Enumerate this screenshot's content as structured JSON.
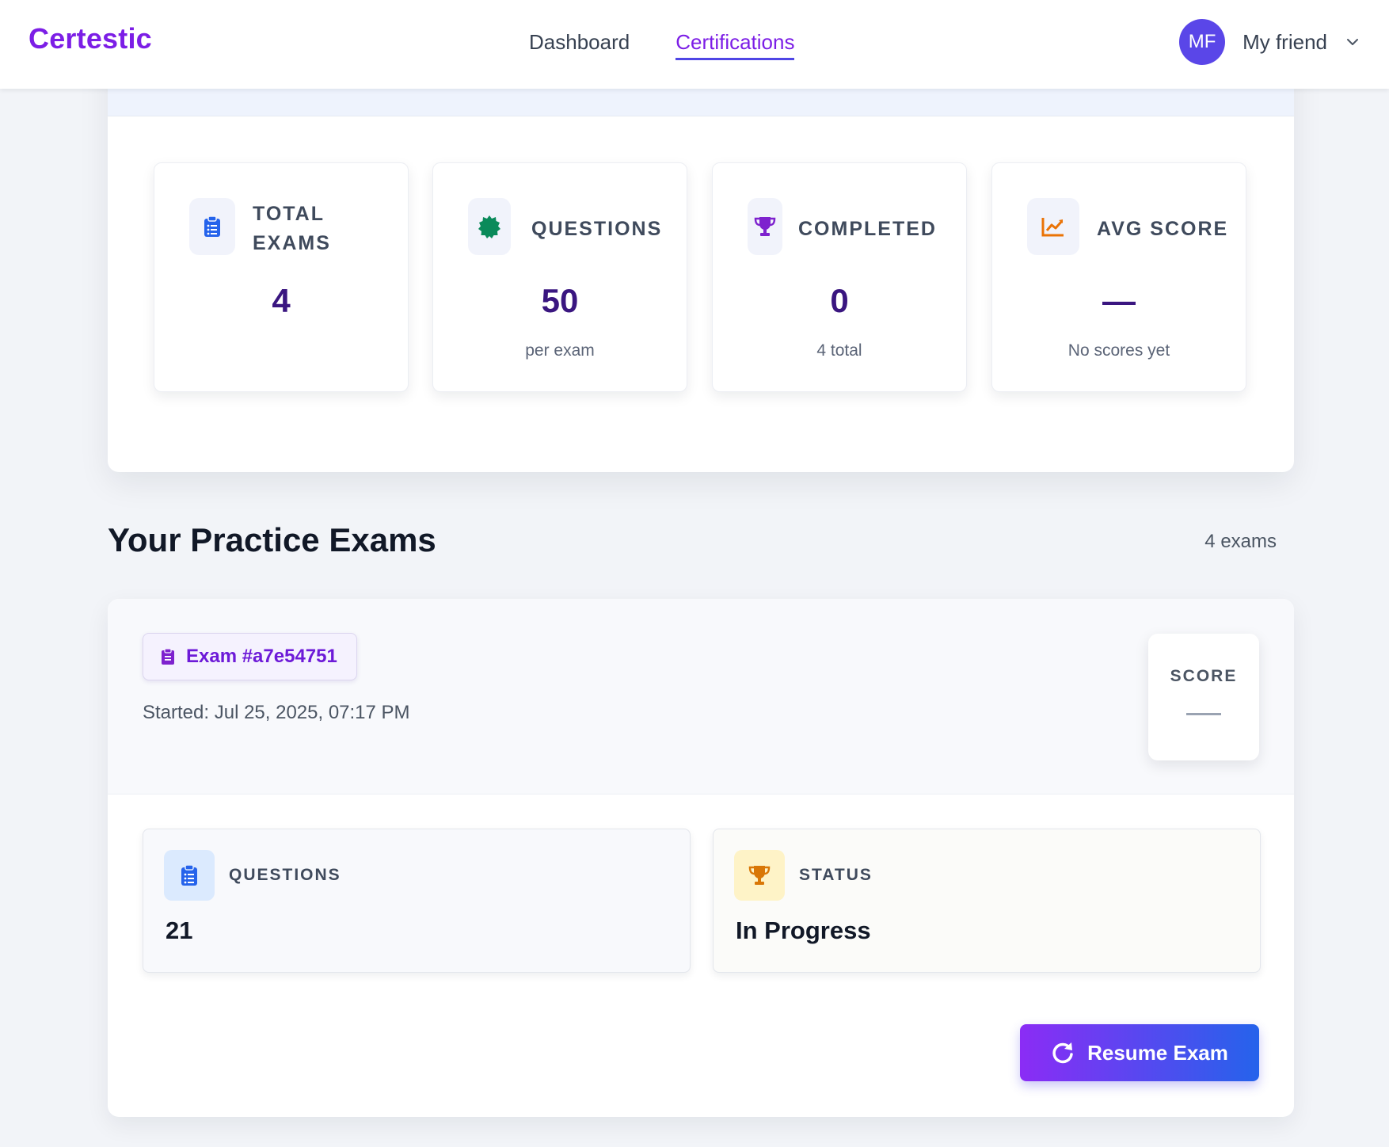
{
  "app": {
    "brand": "Certestic"
  },
  "nav": {
    "items": [
      {
        "label": "Dashboard"
      },
      {
        "label": "Certifications"
      }
    ]
  },
  "user": {
    "initials": "MF",
    "name": "My friend"
  },
  "stats": [
    {
      "label": "TOTAL EXAMS",
      "value": "4",
      "sub": "",
      "icon": "clipboard-list-icon"
    },
    {
      "label": "QUESTIONS",
      "value": "50",
      "sub": "per exam",
      "icon": "badge-icon"
    },
    {
      "label": "COMPLETED",
      "value": "0",
      "sub": "4 total",
      "icon": "trophy-icon"
    },
    {
      "label": "AVG SCORE",
      "value": "—",
      "sub": "No scores yet",
      "icon": "chart-line-icon"
    }
  ],
  "section": {
    "title": "Your Practice Exams",
    "count": "4 exams"
  },
  "exam": {
    "id": "Exam #a7e54751",
    "started": "Started:  Jul 25, 2025, 07:17 PM",
    "score_label": "SCORE",
    "questions_label": "QUESTIONS",
    "questions_value": "21",
    "status_label": "STATUS",
    "status_value": "In Progress",
    "resume_label": "Resume Exam"
  },
  "colors": {
    "brand": "#7c1ee6",
    "avatar": "#5a46e8",
    "stat_value": "#3a1680",
    "button_start": "#8b2cf5",
    "button_end": "#2563eb"
  }
}
